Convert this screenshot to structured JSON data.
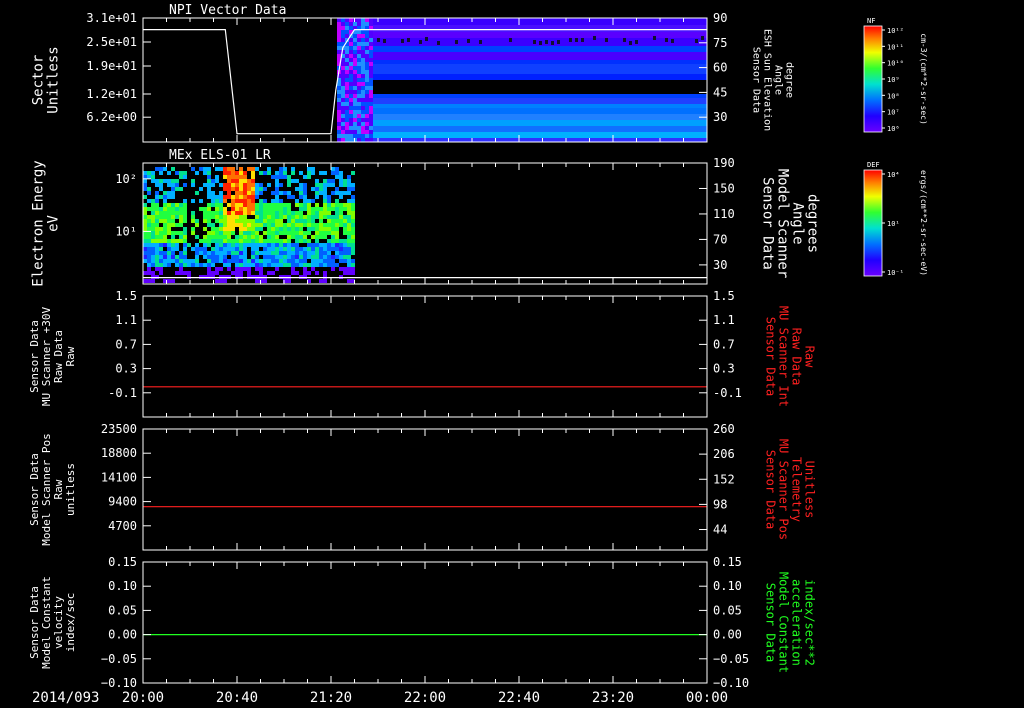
{
  "time_axis": {
    "date_label": "2014/093",
    "ticks": [
      "20:00",
      "20:40",
      "21:20",
      "22:00",
      "22:40",
      "23:20",
      "00:00"
    ],
    "range": [
      "20:00",
      "24:00"
    ]
  },
  "colors": {
    "axis": "#ffffff",
    "trace_red": "#ff2020",
    "trace_green": "#20ff20"
  },
  "colorbars": [
    {
      "title": "NF",
      "unit": "cm-3/(cm**2-sr-sec)",
      "tick_labels": [
        "10¹²",
        "10¹¹",
        "10¹⁰",
        "10⁹",
        "10⁸",
        "10⁷",
        "10⁶"
      ]
    },
    {
      "title": "DEF",
      "unit": "ergs/(cm**2-sr-sec-eV)",
      "tick_labels": [
        "10⁴",
        "10¹",
        "10⁻¹"
      ]
    }
  ],
  "chart_data": [
    {
      "type": "heatmap",
      "title": "NPI Vector Data",
      "ylabel": [
        "Sector",
        "Unitless"
      ],
      "y_ticks": [
        "3.1e+01",
        "2.5e+01",
        "1.9e+01",
        "1.2e+01",
        "6.2e+00"
      ],
      "y_tick_values": [
        31,
        25,
        19,
        12,
        6.2
      ],
      "ylim": [
        0,
        31
      ],
      "y2label": [
        "Sensor Data",
        "ESH Sun Elevation",
        "Angle",
        "degree"
      ],
      "y2_ticks": [
        "90",
        "75",
        "60",
        "45",
        "30"
      ],
      "y2_tick_values": [
        90,
        75,
        60,
        45,
        30
      ],
      "y2lim": [
        15,
        90
      ],
      "data_time_range": [
        "21:20",
        "24:00"
      ],
      "overlay_line": {
        "x": [
          "20:00",
          "20:35",
          "20:40",
          "21:15",
          "21:20",
          "21:22",
          "21:25",
          "21:30",
          "24:00"
        ],
        "y": [
          83,
          83,
          20,
          20,
          20,
          46,
          72,
          83,
          83
        ]
      }
    },
    {
      "type": "heatmap",
      "title": "MEx ELS-01 LR",
      "ylabel": [
        "Electron Energy",
        "eV"
      ],
      "y_ticks": [
        "10²",
        "10¹"
      ],
      "y_tick_values": [
        100,
        10
      ],
      "ylim": [
        1.0,
        200
      ],
      "yscale": "log",
      "y2label": [
        "Sensor Data",
        "Model Scanner",
        "Angle",
        "degrees"
      ],
      "y2_ticks": [
        "190",
        "150",
        "110",
        "70",
        "30"
      ],
      "y2_tick_values": [
        190,
        150,
        110,
        70,
        30
      ],
      "y2lim": [
        0,
        190
      ],
      "data_time_range": [
        "20:00",
        "21:29"
      ],
      "overlay_line": {
        "x": [
          "20:00",
          "24:00"
        ],
        "y": [
          10,
          10
        ]
      }
    },
    {
      "type": "line",
      "ylabel": [
        "Sensor Data",
        "MU Scanner +30V",
        "Raw Data",
        "Raw"
      ],
      "y_ticks": [
        "1.5",
        "1.1",
        "0.7",
        "0.3",
        "-0.1"
      ],
      "y_tick_values": [
        1.5,
        1.1,
        0.7,
        0.3,
        -0.1
      ],
      "ylim": [
        -0.5,
        1.5
      ],
      "y2label": [
        "Sensor Data",
        "MU Scanner Int",
        "Raw Data",
        "Raw"
      ],
      "y2_ticks": [
        "1.5",
        "1.1",
        "0.7",
        "0.3",
        "-0.1"
      ],
      "y2_tick_values": [
        1.5,
        1.1,
        0.7,
        0.3,
        -0.1
      ],
      "y2lim": [
        -0.5,
        1.5
      ],
      "series": [
        {
          "x": [
            "20:00",
            "24:00"
          ],
          "values": [
            0,
            0
          ]
        }
      ]
    },
    {
      "type": "line",
      "ylabel": [
        "Sensor Data",
        "Model Scanner Pos",
        "Raw",
        "unitless"
      ],
      "y_ticks": [
        "23500",
        "18800",
        "14100",
        "9400",
        "4700"
      ],
      "y_tick_values": [
        23500,
        18800,
        14100,
        9400,
        4700
      ],
      "ylim": [
        0,
        23500
      ],
      "y2label": [
        "Sensor Data",
        "MU Scanner Pos",
        "Telemetry",
        "Unitless"
      ],
      "y2_ticks": [
        "260",
        "206",
        "152",
        "98",
        "44"
      ],
      "y2_tick_values": [
        260,
        206,
        152,
        98,
        44
      ],
      "y2lim": [
        0,
        260
      ],
      "series": [
        {
          "x": [
            "20:00",
            "24:00"
          ],
          "values": [
            8400,
            8400
          ]
        }
      ]
    },
    {
      "type": "line",
      "ylabel": [
        "Sensor Data",
        "Model Constant",
        "velocity",
        "index/sec"
      ],
      "y_ticks": [
        "0.15",
        "0.10",
        "0.05",
        "0.00",
        "−0.05",
        "−0.10"
      ],
      "y_tick_values": [
        0.15,
        0.1,
        0.05,
        0.0,
        -0.05,
        -0.1
      ],
      "ylim": [
        -0.1,
        0.15
      ],
      "y2label": [
        "Sensor Data",
        "Model Constant",
        "acceleration",
        "index/sec**2"
      ],
      "y2_ticks": [
        "0.15",
        "0.10",
        "0.05",
        "0.00",
        "−0.05",
        "−0.10"
      ],
      "y2_tick_values": [
        0.15,
        0.1,
        0.05,
        0.0,
        -0.05,
        -0.1
      ],
      "y2lim": [
        -0.1,
        0.15
      ],
      "series": [
        {
          "x": [
            "20:00",
            "24:00"
          ],
          "values": [
            0.0,
            0.0
          ]
        }
      ]
    }
  ]
}
